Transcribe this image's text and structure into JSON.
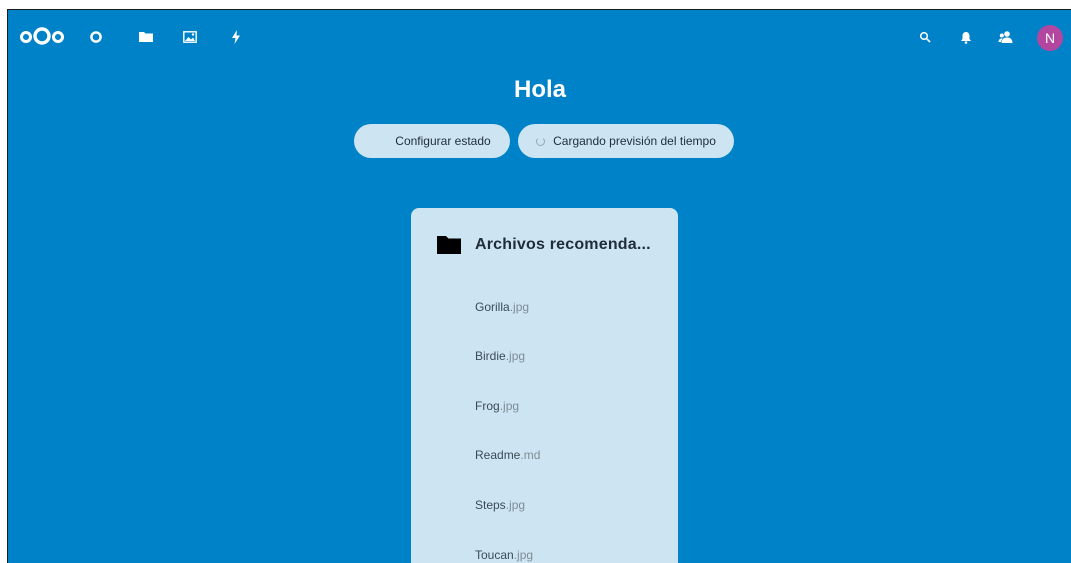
{
  "topbar": {
    "apps": [
      {
        "name": "dashboard",
        "icon": "circle-icon"
      },
      {
        "name": "files",
        "icon": "folder-icon"
      },
      {
        "name": "photos",
        "icon": "image-icon"
      },
      {
        "name": "activity",
        "icon": "lightning-icon"
      }
    ],
    "right_icons": [
      "search-icon",
      "bell-icon",
      "contacts-icon"
    ],
    "avatar_initial": "N"
  },
  "main": {
    "greeting": "Hola",
    "status_button_label": "Configurar estado",
    "weather_button_label": "Cargando previsión del tiempo"
  },
  "widget": {
    "title": "Archivos recomenda...",
    "files": [
      {
        "base": "Gorilla",
        "ext": ".jpg"
      },
      {
        "base": "Birdie",
        "ext": ".jpg"
      },
      {
        "base": "Frog",
        "ext": ".jpg"
      },
      {
        "base": "Readme",
        "ext": ".md"
      },
      {
        "base": "Steps",
        "ext": ".jpg"
      },
      {
        "base": "Toucan",
        "ext": ".jpg"
      }
    ]
  },
  "colors": {
    "background": "#0082c9",
    "panel": "#cde5f3",
    "avatar": "#b3469f"
  }
}
